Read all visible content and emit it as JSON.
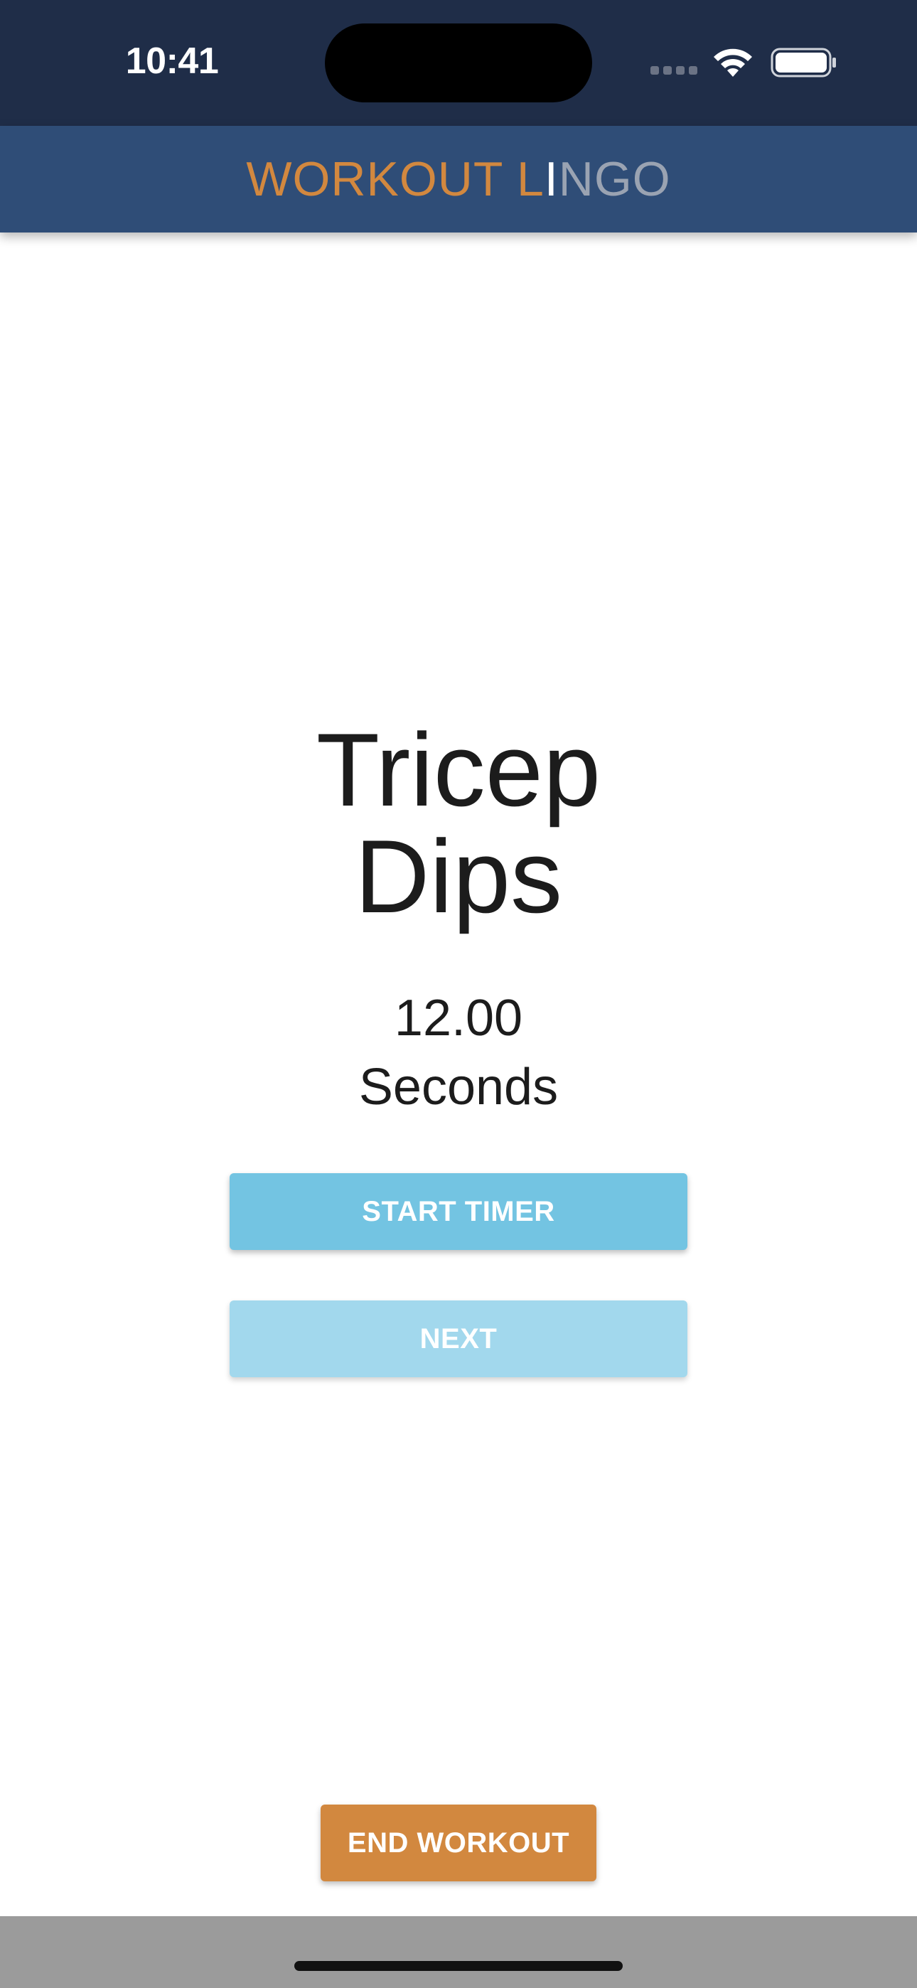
{
  "status_bar": {
    "time": "10:41",
    "icons": [
      "signal-icon",
      "wifi-icon",
      "battery-icon"
    ]
  },
  "app_bar": {
    "title_part1": "WORKOUT L",
    "title_part2": "I",
    "title_part3": "NGO"
  },
  "exercise": {
    "name_line1": "Tricep",
    "name_line2": "Dips",
    "time_value": "12.00",
    "time_unit": "Seconds"
  },
  "buttons": {
    "start_timer": "START TIMER",
    "next": "NEXT",
    "end_workout": "END WORKOUT"
  },
  "colors": {
    "status_bar_bg": "#1f2d48",
    "app_bar_bg": "#2f4d77",
    "title_orange": "#d2883f",
    "start_button": "#73c4e2",
    "next_button": "#a2d8ed",
    "end_button": "#d2883f",
    "bottom_bar": "#9b9b9b"
  }
}
